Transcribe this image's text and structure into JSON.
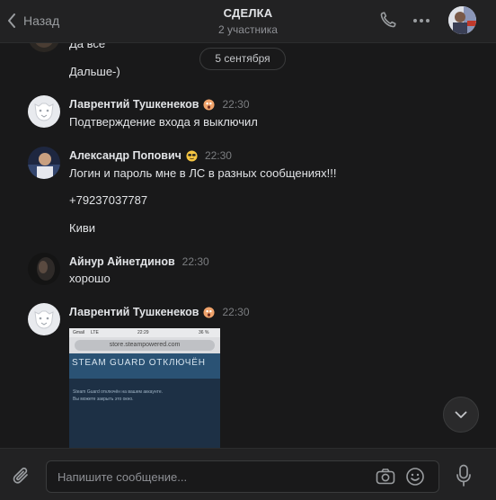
{
  "header": {
    "back_label": "Назад",
    "title": "СДЕЛКА",
    "subtitle": "2 участника"
  },
  "feed": {
    "partial_messages": [
      "Да все",
      "Дальше-)"
    ],
    "date_separator": "5 сентября",
    "messages": [
      {
        "author": "Лаврентий Тушкенеков",
        "status_icon": "shocked-emoji-icon",
        "time": "22:30",
        "lines": [
          "Подтверждение входа я выключил"
        ]
      },
      {
        "author": "Александр Попович",
        "status_icon": "sunglasses-emoji-icon",
        "time": "22:30",
        "lines": [
          "Логин и пароль мне в ЛС в разных сообщениях!!!",
          "+79237037787",
          "Киви"
        ]
      },
      {
        "author": "Айнур Айнетдинов",
        "time": "22:30",
        "lines": [
          "хорошо"
        ]
      },
      {
        "author": "Лаврентий Тушкенеков",
        "status_icon": "shocked-emoji-icon",
        "time": "22:30",
        "lines": []
      }
    ],
    "attachment": {
      "status_carrier": "Gmail",
      "status_net": "LTE",
      "status_time": "22:29",
      "status_battery": "36 %",
      "url": "store.steampowered.com",
      "heading": "STEAM GUARD ОТКЛЮЧЁН",
      "line1": "Steam Guard отключён на вашем аккаунте.",
      "line2": "Вы можете закрыть это окно."
    }
  },
  "composer": {
    "placeholder": "Напишите сообщение..."
  },
  "colors": {
    "background": "#19191a",
    "panel": "#222223",
    "text": "#e1e3e6",
    "muted": "#8e9095"
  }
}
